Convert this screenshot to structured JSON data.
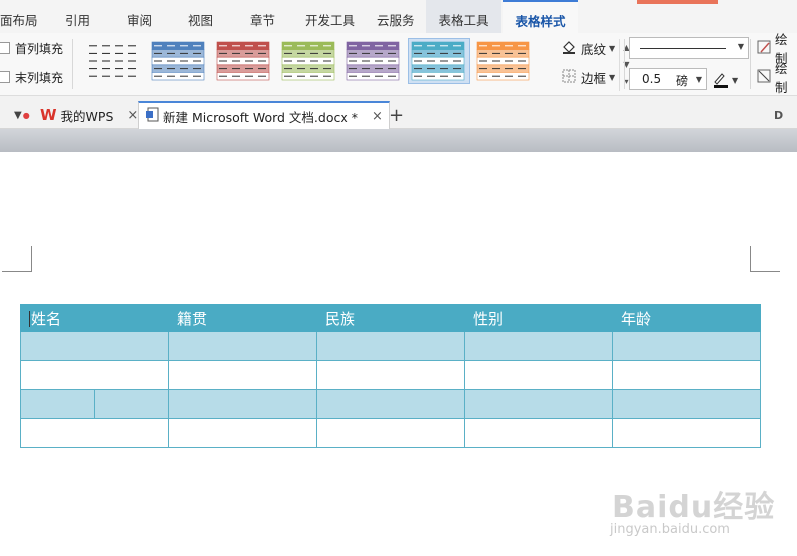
{
  "menu": {
    "tabs": [
      {
        "label": "面布局"
      },
      {
        "label": "引用"
      },
      {
        "label": "审阅"
      },
      {
        "label": "视图"
      },
      {
        "label": "章节"
      },
      {
        "label": "开发工具"
      },
      {
        "label": "云服务"
      },
      {
        "label": "表格工具"
      },
      {
        "label": "表格样式"
      }
    ],
    "active_tab": "表格样式"
  },
  "ribbon": {
    "first_col_fill": "首列填充",
    "last_col_fill": "末列填充",
    "shading_label": "底纹",
    "border_label": "边框",
    "line_weight_value": "0.5",
    "line_weight_unit": "磅",
    "draw_table_label": "绘制",
    "eraser_label": "绘制",
    "style_colors": [
      "#333333",
      "#4f81bd",
      "#c0504d",
      "#9bbb59",
      "#8064a2",
      "#4bacc6",
      "#f79646"
    ]
  },
  "docbar": {
    "wps_tab": "我的WPS",
    "doc_tab": "新建 Microsoft Word 文档.docx *",
    "new_tab_symbol": "+",
    "close_symbol": "×"
  },
  "table": {
    "header": [
      "姓名",
      "籍贯",
      "民族",
      "性别",
      "年龄"
    ],
    "header_color": "#4aabc4",
    "band_color": "#b7dce8"
  },
  "watermark": {
    "logo": "Baidu经验",
    "url": "jingyan.baidu.com"
  }
}
